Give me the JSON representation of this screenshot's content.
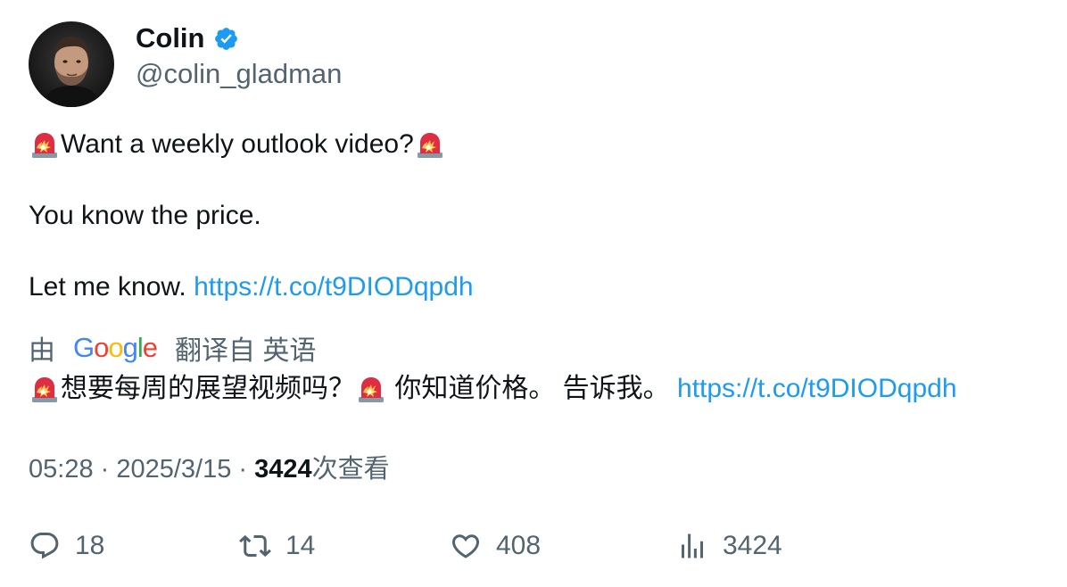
{
  "author": {
    "display_name": "Colin",
    "handle": "@colin_gladman",
    "verified_icon": "verified-badge-icon"
  },
  "tweet": {
    "line1": "Want a weekly outlook video?",
    "line2": "You know the price.",
    "line3_text": "Let me know. ",
    "link": "https://t.co/t9DIODqpdh"
  },
  "translation": {
    "by": "由",
    "provider": "Google",
    "translated_from": "翻译自 英语",
    "text_part1": "想要每周的展望视频吗？",
    "text_part2": " 你知道价格。 告诉我。 ",
    "link": "https://t.co/t9DIODqpdh"
  },
  "meta": {
    "time": "05:28",
    "separator": " · ",
    "date": "2025/3/15",
    "views_count": "3424",
    "views_label": "次查看"
  },
  "actions": {
    "replies": "18",
    "retweets": "14",
    "likes": "408",
    "views": "3424"
  },
  "colors": {
    "link": "#1d9bf0",
    "secondary_text": "#536471",
    "primary_text": "#0f1419"
  }
}
